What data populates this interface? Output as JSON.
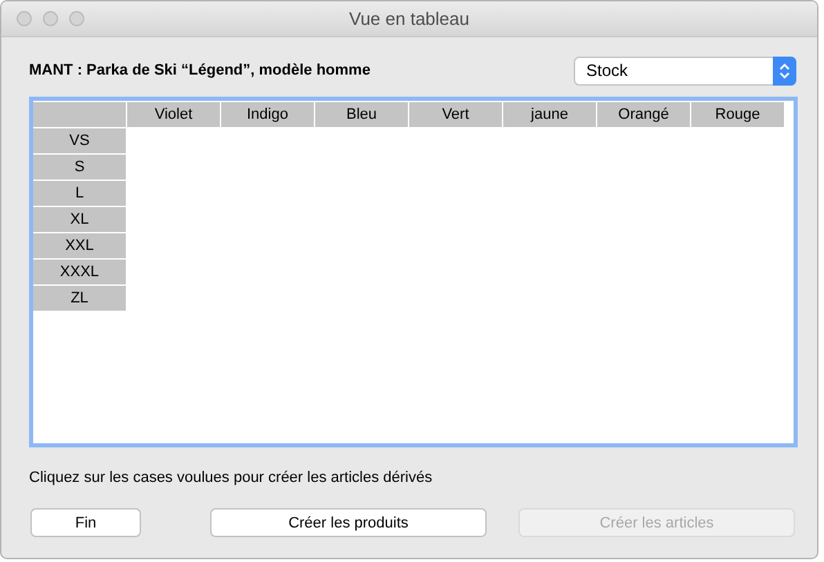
{
  "window": {
    "title": "Vue en tableau"
  },
  "product_title": "MANT : Parka de Ski “Légend”, modèle homme",
  "view_select": {
    "value": "Stock"
  },
  "grid": {
    "columns": [
      "Violet",
      "Indigo",
      "Bleu",
      "Vert",
      "jaune",
      "Orangé",
      "Rouge"
    ],
    "rows": [
      "VS",
      "S",
      "L",
      "XL",
      "XXL",
      "XXXL",
      "ZL"
    ]
  },
  "instruction": "Cliquez sur les cases voulues pour créer les articles dérivés",
  "buttons": [
    {
      "label": "Fin",
      "disabled": false
    },
    {
      "label": "Créer les produits",
      "disabled": false
    },
    {
      "label": "Créer les articles",
      "disabled": true
    }
  ]
}
